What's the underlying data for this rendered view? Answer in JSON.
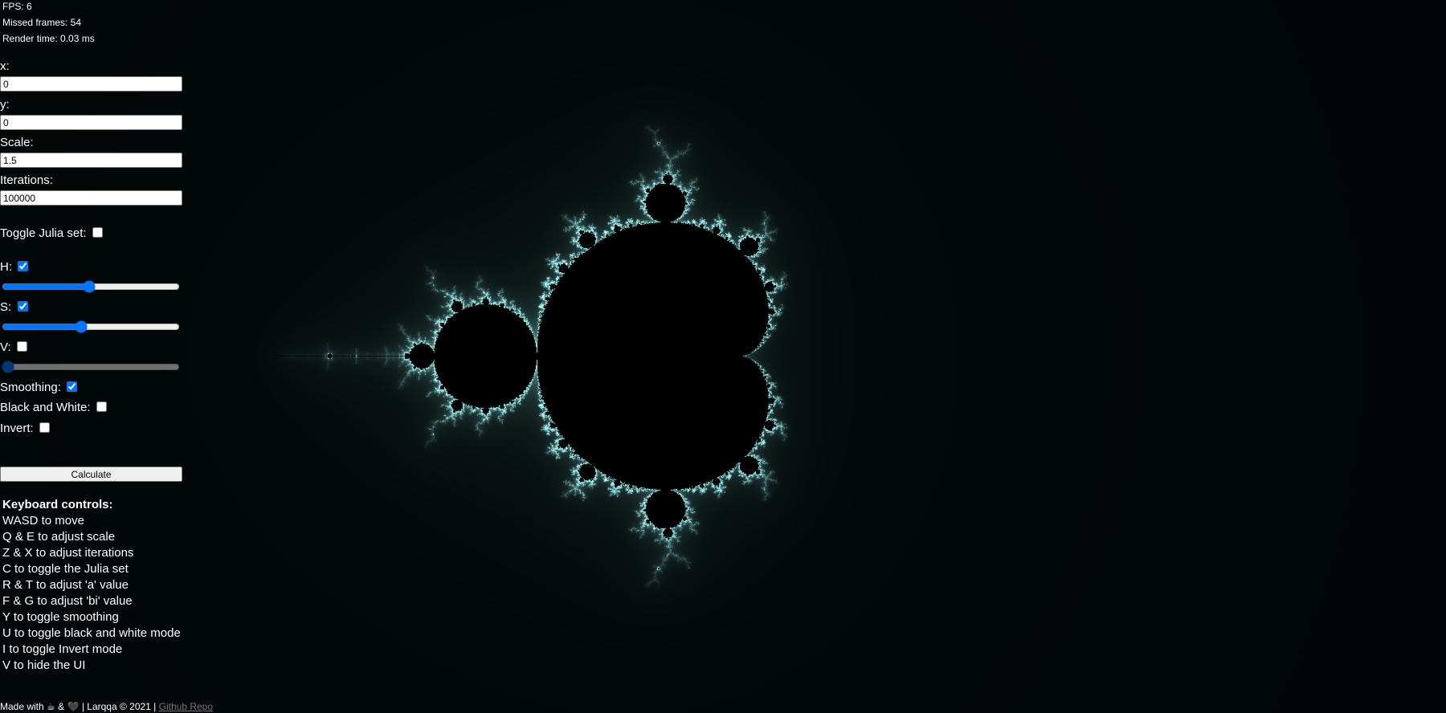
{
  "stats": {
    "fps": "FPS: 6",
    "missed_frames": "Missed frames: 54",
    "render_time": "Render time: 0.03 ms"
  },
  "inputs": {
    "x_label": "x:",
    "x_value": "0",
    "y_label": "y:",
    "y_value": "0",
    "scale_label": "Scale:",
    "scale_value": "1.5",
    "iterations_label": "Iterations:",
    "iterations_value": "100000"
  },
  "toggles": {
    "julia_label": "Toggle Julia set:",
    "julia_checked": false,
    "h_label": "H:",
    "h_checked": true,
    "h_value": 0.49,
    "s_label": "S:",
    "s_checked": true,
    "s_value": 0.44,
    "v_label": "V:",
    "v_checked": false,
    "v_value": 0.0,
    "smoothing_label": "Smoothing:",
    "smoothing_checked": true,
    "bw_label": "Black and White:",
    "bw_checked": false,
    "invert_label": "Invert:",
    "invert_checked": false
  },
  "calculate_label": "Calculate",
  "keyboard": {
    "title": "Keyboard controls:",
    "items": [
      "WASD to move",
      "Q & E to adjust scale",
      "Z & X to adjust iterations",
      "C to toggle the Julia set",
      "R & T to adjust 'a' value",
      "F & G to adjust 'bi' value",
      "Y to toggle smoothing",
      "U to toggle black and white mode",
      "I to toggle Invert mode",
      "V to hide the UI"
    ]
  },
  "footer": {
    "made_with": "Made with",
    "coffee_icon": "☕",
    "amp": "&",
    "heart_icon": "🖤",
    "credit": "| Larqqa © 2021 |",
    "repo_link": "Github Repo"
  },
  "colors": {
    "background": "#000000",
    "fractal_glow": "#7fe0e6",
    "accent": "#0075ff"
  }
}
